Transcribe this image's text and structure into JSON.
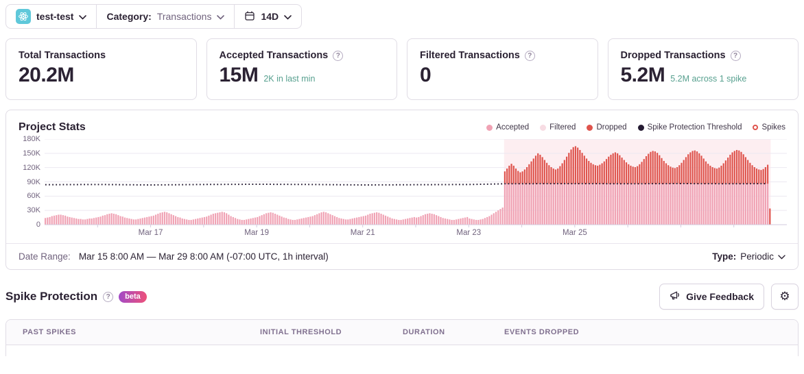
{
  "topbar": {
    "project_name": "test-test",
    "category_label": "Category:",
    "category_value": "Transactions",
    "date_value": "14D"
  },
  "cards": [
    {
      "title": "Total Transactions",
      "value": "20.2M",
      "subtext": ""
    },
    {
      "title": "Accepted Transactions",
      "value": "15M",
      "subtext": "2K in last min"
    },
    {
      "title": "Filtered Transactions",
      "value": "0",
      "subtext": ""
    },
    {
      "title": "Dropped Transactions",
      "value": "5.2M",
      "subtext": "5.2M across 1 spike"
    }
  ],
  "chart_panel": {
    "title": "Project Stats",
    "legend": [
      {
        "label": "Accepted",
        "marker": "dot",
        "color": "#f0a2b4"
      },
      {
        "label": "Filtered",
        "marker": "dot",
        "color": "#f7dce3"
      },
      {
        "label": "Dropped",
        "marker": "dot",
        "color": "#df544d"
      },
      {
        "label": "Spike Protection Threshold",
        "marker": "dot",
        "color": "#241a32"
      },
      {
        "label": "Spikes",
        "marker": "ring",
        "color": "#df544d"
      }
    ],
    "footer": {
      "date_range_label": "Date Range:",
      "date_range_value": "Mar 15 8:00 AM — Mar 29 8:00 AM (-07:00 UTC, 1h interval)",
      "type_label": "Type:",
      "type_value": "Periodic"
    }
  },
  "spike_section": {
    "heading": "Spike Protection",
    "beta_label": "beta",
    "feedback_button": "Give Feedback"
  },
  "table": {
    "headers": [
      "PAST SPIKES",
      "INITIAL THRESHOLD",
      "DURATION",
      "EVENTS DROPPED"
    ]
  },
  "chart_data": {
    "type": "bar",
    "title": "Project Stats",
    "unit": "thousands of transactions per hour",
    "interval": "1h",
    "start": "Mar 15 8:00 AM",
    "end": "Mar 29 8:00 AM",
    "hours_total": 336,
    "y_max": 180,
    "grid": true,
    "legend_position": "top-right",
    "y_ticks": [
      {
        "value": 180,
        "label": "180K"
      },
      {
        "value": 150,
        "label": "150K"
      },
      {
        "value": 120,
        "label": "120K"
      },
      {
        "value": 90,
        "label": "90K"
      },
      {
        "value": 60,
        "label": "60K"
      },
      {
        "value": 30,
        "label": "30K"
      },
      {
        "value": 0,
        "label": "0"
      }
    ],
    "x_labels": [
      {
        "hour": 48,
        "label": "Mar 17"
      },
      {
        "hour": 96,
        "label": "Mar 19"
      },
      {
        "hour": 144,
        "label": "Mar 21"
      },
      {
        "hour": 192,
        "label": "Mar 23"
      },
      {
        "hour": 240,
        "label": "Mar 25"
      }
    ],
    "x_tick_every_hours": 24,
    "spike_region": {
      "start_hour": 208,
      "end_hour": 328
    },
    "accepted_prespike": [
      14,
      15,
      16,
      18,
      19,
      20,
      21,
      21,
      20,
      19,
      17,
      16,
      15,
      14,
      13,
      12,
      12,
      11,
      11,
      12,
      13,
      13,
      14,
      15,
      16,
      17,
      19,
      20,
      22,
      23,
      24,
      23,
      22,
      20,
      18,
      17,
      15,
      14,
      13,
      12,
      11,
      11,
      12,
      13,
      14,
      15,
      16,
      17,
      18,
      19,
      21,
      23,
      25,
      26,
      27,
      26,
      24,
      22,
      20,
      18,
      16,
      15,
      13,
      12,
      11,
      10,
      10,
      11,
      12,
      13,
      14,
      15,
      16,
      17,
      19,
      21,
      23,
      24,
      25,
      26,
      27,
      26,
      24,
      21,
      18,
      16,
      14,
      12,
      11,
      10,
      10,
      11,
      12,
      13,
      14,
      15,
      16,
      18,
      20,
      22,
      24,
      25,
      26,
      25,
      23,
      21,
      19,
      17,
      15,
      14,
      12,
      11,
      10,
      10,
      11,
      12,
      13,
      14,
      15,
      16,
      17,
      18,
      20,
      22,
      24,
      26,
      27,
      26,
      24,
      22,
      20,
      18,
      16,
      14,
      13,
      12,
      11,
      11,
      12,
      13,
      14,
      15,
      16,
      17,
      18,
      19,
      21,
      23,
      24,
      25,
      26,
      25,
      23,
      21,
      19,
      17,
      15,
      13,
      12,
      11,
      10,
      10,
      11,
      12,
      13,
      14,
      15,
      16,
      15,
      16,
      18,
      20,
      22,
      23,
      24,
      23,
      22,
      20,
      18,
      16,
      14,
      13,
      12,
      11,
      10,
      10,
      11,
      12,
      13,
      14,
      15,
      16,
      13,
      12,
      11,
      10,
      10,
      11,
      12,
      14,
      16,
      18,
      21,
      24,
      27,
      30,
      33,
      36
    ],
    "accepted_during_spike": 86,
    "dropped_spike": [
      26,
      32,
      38,
      42,
      38,
      32,
      27,
      24,
      26,
      30,
      35,
      41,
      47,
      53,
      59,
      64,
      61,
      56,
      50,
      44,
      39,
      35,
      32,
      30,
      32,
      37,
      43,
      50,
      57,
      65,
      72,
      77,
      79,
      76,
      71,
      65,
      59,
      53,
      48,
      44,
      41,
      39,
      38,
      40,
      43,
      47,
      52,
      57,
      61,
      64,
      66,
      64,
      60,
      55,
      50,
      45,
      41,
      38,
      36,
      35,
      37,
      41,
      46,
      52,
      58,
      63,
      67,
      69,
      68,
      65,
      60,
      54,
      48,
      43,
      39,
      36,
      34,
      33,
      35,
      39,
      44,
      50,
      56,
      62,
      66,
      69,
      70,
      68,
      64,
      59,
      53,
      47,
      42,
      38,
      35,
      33,
      32,
      34,
      38,
      43,
      49,
      55,
      61,
      66,
      69,
      71,
      70,
      67,
      62,
      56,
      50,
      44,
      39,
      35,
      32,
      30,
      29,
      31,
      35,
      40
    ],
    "last_partial_bar": {
      "hour": 328,
      "dropped": 34
    },
    "threshold_points": [
      [
        0,
        84
      ],
      [
        24,
        84.5
      ],
      [
        48,
        83.5
      ],
      [
        72,
        84.5
      ],
      [
        96,
        85
      ],
      [
        120,
        84.5
      ],
      [
        144,
        83.5
      ],
      [
        168,
        84
      ],
      [
        192,
        84.5
      ],
      [
        204,
        85.5
      ],
      [
        208,
        86
      ],
      [
        240,
        86.3
      ],
      [
        264,
        86
      ],
      [
        288,
        86.4
      ],
      [
        312,
        86
      ],
      [
        327,
        86.3
      ]
    ],
    "colors": {
      "accepted": "#f0a2b4",
      "filtered": "#f7dce3",
      "dropped": "#df544d",
      "threshold": "#241a32",
      "spike_region_fill": "#fdeef1",
      "grid_line": "#ece8f1",
      "axis_line": "#d2cadd"
    }
  }
}
